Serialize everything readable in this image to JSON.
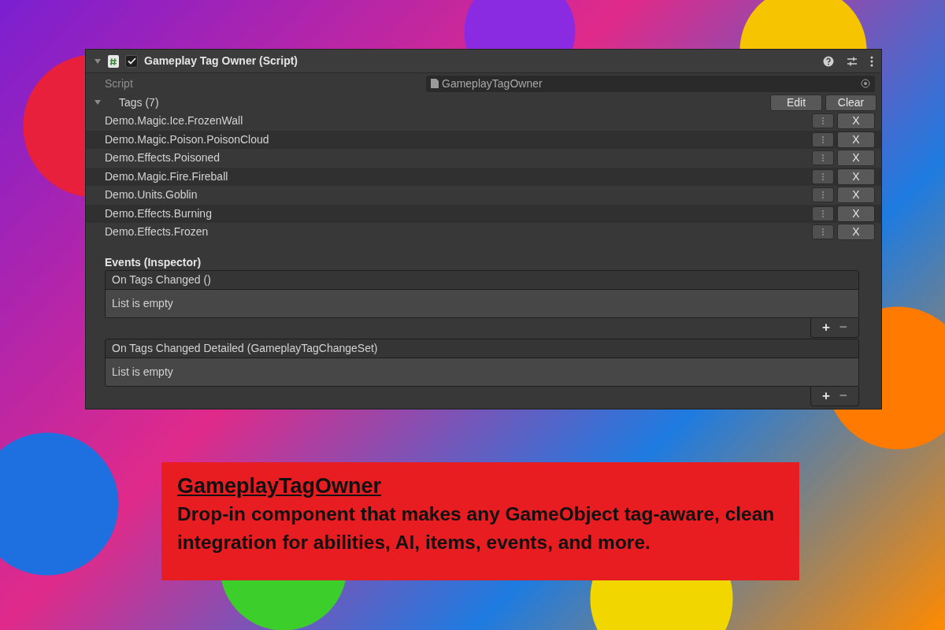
{
  "component": {
    "title": "Gameplay Tag Owner (Script)",
    "expanded": true,
    "enabled": true,
    "script_label": "Script",
    "script_value": "GameplayTagOwner"
  },
  "tags": {
    "label": "Tags (7)",
    "expanded": true,
    "buttons": [
      "Edit",
      "Clear"
    ],
    "items": [
      {
        "name": "Demo.Magic.Ice.FrozenWall",
        "remove": "X"
      },
      {
        "name": "Demo.Magic.Poison.PoisonCloud",
        "remove": "X"
      },
      {
        "name": "Demo.Effects.Poisoned",
        "remove": "X"
      },
      {
        "name": "Demo.Magic.Fire.Fireball",
        "remove": "X"
      },
      {
        "name": "Demo.Units.Goblin",
        "remove": "X"
      },
      {
        "name": "Demo.Effects.Burning",
        "remove": "X"
      },
      {
        "name": "Demo.Effects.Frozen",
        "remove": "X"
      }
    ]
  },
  "events": {
    "heading": "Events (Inspector)",
    "lists": [
      {
        "title": "On Tags Changed ()",
        "empty_text": "List is empty",
        "add": "+",
        "remove": "−"
      },
      {
        "title": "On Tags Changed Detailed (GameplayTagChangeSet)",
        "empty_text": "List is empty",
        "add": "+",
        "remove": "−"
      }
    ]
  },
  "caption": {
    "title": "GameplayTagOwner",
    "text": "Drop-in component that makes any GameObject tag-aware, clean integration for abilities, AI, items, events, and more."
  }
}
